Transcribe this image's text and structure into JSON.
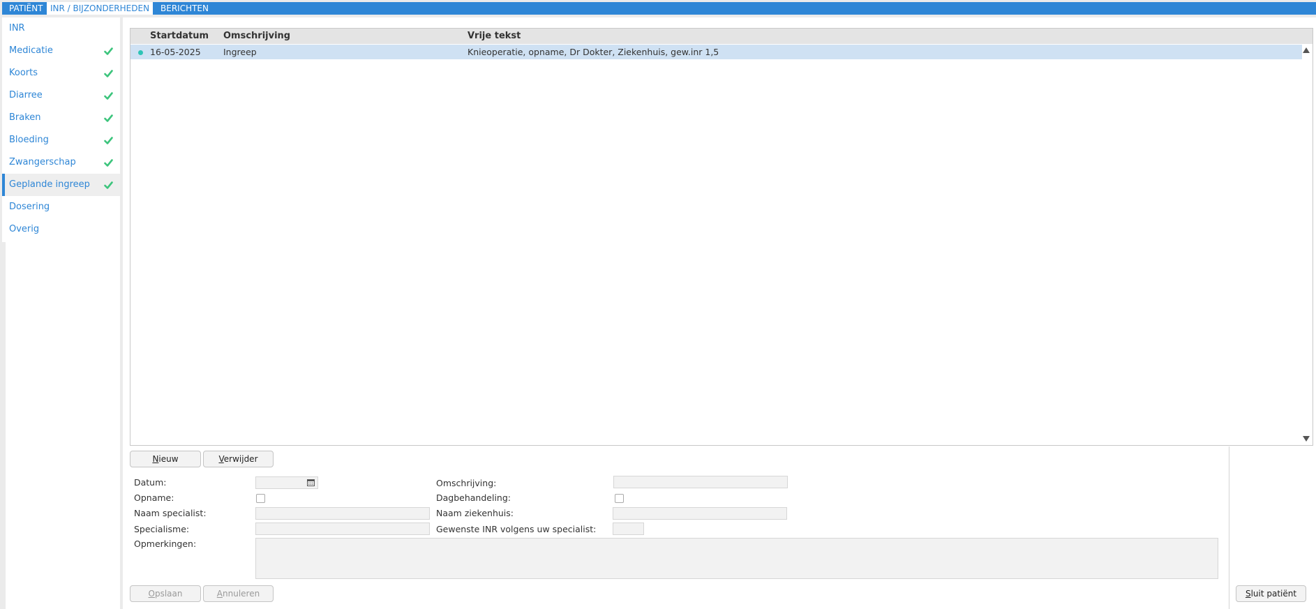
{
  "tabs": [
    "PATIËNT",
    "INR / BIJZONDERHEDEN",
    "BERICHTEN"
  ],
  "sidebar": {
    "items": [
      {
        "label": "INR",
        "checked": false
      },
      {
        "label": "Medicatie",
        "checked": true
      },
      {
        "label": "Koorts",
        "checked": true
      },
      {
        "label": "Diarree",
        "checked": true
      },
      {
        "label": "Braken",
        "checked": true
      },
      {
        "label": "Bloeding",
        "checked": true
      },
      {
        "label": "Zwangerschap",
        "checked": true
      },
      {
        "label": "Geplande ingreep",
        "checked": true,
        "active": true
      },
      {
        "label": "Dosering",
        "checked": false
      },
      {
        "label": "Overig",
        "checked": false
      }
    ],
    "check_color": "#3cc47c"
  },
  "grid": {
    "columns": [
      "Startdatum",
      "Omschrijving",
      "Vrije tekst"
    ],
    "rows": [
      {
        "startdatum": "16-05-2025",
        "omschrijving": "Ingreep",
        "vrije_tekst": "Knieoperatie, opname, Dr Dokter, Ziekenhuis, gew.inr 1,5",
        "selected": true
      }
    ]
  },
  "buttons": {
    "nieuw": {
      "accel": "N",
      "rest": "ieuw"
    },
    "verwijder": {
      "accel": "V",
      "rest": "erwijder"
    },
    "opslaan": {
      "accel": "O",
      "rest": "pslaan"
    },
    "annuleren": {
      "accel": "A",
      "rest": "nnuleren"
    },
    "sluit": {
      "accel": "S",
      "rest": "luit patiënt"
    }
  },
  "form": {
    "datum_label": "Datum:",
    "opname_label": "Opname:",
    "naam_specialist_label": "Naam specialist:",
    "specialisme_label": "Specialisme:",
    "opmerkingen_label": "Opmerkingen:",
    "omschrijving_label": "Omschrijving:",
    "dagbehandeling_label": "Dagbehandeling:",
    "naam_ziekenhuis_label": "Naam ziekenhuis:",
    "gewenste_inr_label": "Gewenste INR volgens uw specialist:"
  },
  "colors": {
    "accent": "#2e86d6",
    "selected_row": "#cfe1f3",
    "status_dot": "#2ec4b6"
  }
}
